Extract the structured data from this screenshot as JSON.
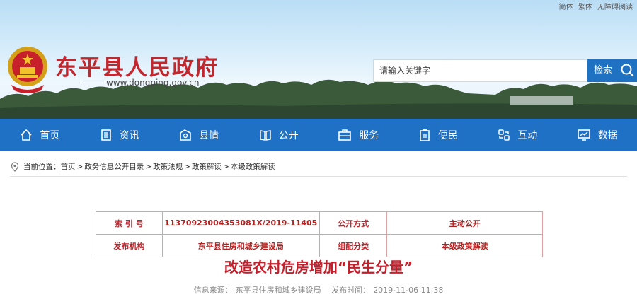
{
  "top_links": [
    "简体",
    "繁体",
    "无障碍阅读"
  ],
  "site": {
    "title": "东平县人民政府",
    "url": "www.dongping.gov.cn",
    "emblem_icon": "national-emblem-icon"
  },
  "search": {
    "placeholder": "请输入关键字",
    "button_label": "检索",
    "icon": "search-icon"
  },
  "nav": [
    {
      "label": "首页",
      "icon": "home-icon"
    },
    {
      "label": "资讯",
      "icon": "news-icon"
    },
    {
      "label": "县情",
      "icon": "county-info-icon"
    },
    {
      "label": "公开",
      "icon": "book-icon"
    },
    {
      "label": "服务",
      "icon": "briefcase-icon"
    },
    {
      "label": "便民",
      "icon": "clipboard-icon"
    },
    {
      "label": "互动",
      "icon": "interaction-icon"
    },
    {
      "label": "数据",
      "icon": "monitor-chart-icon"
    }
  ],
  "breadcrumb": {
    "prefix": "当前位置：",
    "items": [
      "首页",
      "政务信息公开目录",
      "政策法规",
      "政策解读",
      "本级政策解读"
    ],
    "separator": ">"
  },
  "meta_table": {
    "row1": {
      "label1": "索 引 号",
      "value1": "11370923004353081X/2019-11405",
      "label2": "公开方式",
      "value2": "主动公开"
    },
    "row2": {
      "label1": "发布机构",
      "value1": "东平县住房和城乡建设局",
      "label2": "组配分类",
      "value2": "本级政策解读"
    }
  },
  "article": {
    "title": "改造农村危房增加“民生分量”",
    "source_label": "信息来源：",
    "source": "东平县住房和城乡建设局",
    "date_label": "发布时间：",
    "date": "2019-11-06 11:38"
  },
  "colors": {
    "nav_bg": "#1e71c4",
    "title_red": "#c4202c",
    "search_btn": "#1f72c2"
  }
}
